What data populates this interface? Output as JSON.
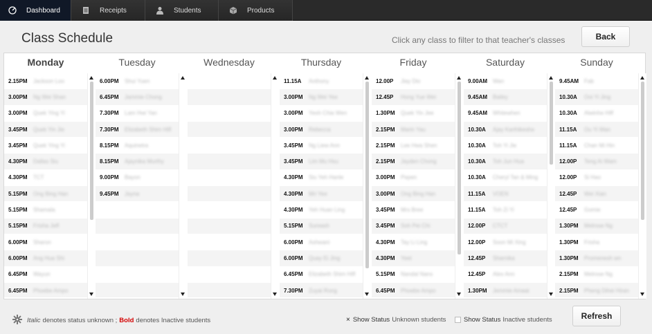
{
  "nav": [
    {
      "label": "Dashboard",
      "icon": "dashboard-icon",
      "active": true
    },
    {
      "label": "Receipts",
      "icon": "receipt-icon",
      "active": false
    },
    {
      "label": "Students",
      "icon": "user-icon",
      "active": false
    },
    {
      "label": "Products",
      "icon": "box-icon",
      "active": false
    }
  ],
  "page_title": "Class Schedule",
  "hint": "Click any class to filter to that teacher's classes",
  "back_label": "Back",
  "refresh_label": "Refresh",
  "days": [
    {
      "name": "Monday",
      "bold": true,
      "rows": [
        {
          "time": "2.15PM",
          "name": "Jackson Loo"
        },
        {
          "time": "3.00PM",
          "name": "Ng Wei Shan"
        },
        {
          "time": "3.00PM",
          "name": "Quek Ying Yi"
        },
        {
          "time": "3.45PM",
          "name": "Quek Yin Jie"
        },
        {
          "time": "3.45PM",
          "name": "Quek Ying Yi"
        },
        {
          "time": "4.30PM",
          "name": "Dallas Siu"
        },
        {
          "time": "4.30PM",
          "name": "TCT"
        },
        {
          "time": "5.15PM",
          "name": "Ong Bing Han"
        },
        {
          "time": "5.15PM",
          "name": "Shamala"
        },
        {
          "time": "5.15PM",
          "name": "Frisha Jeff"
        },
        {
          "time": "6.00PM",
          "name": "Sharon"
        },
        {
          "time": "6.00PM",
          "name": "Ang Hua Shi"
        },
        {
          "time": "6.45PM",
          "name": "Wayun"
        },
        {
          "time": "6.45PM",
          "name": "Phoebe Ampo"
        }
      ]
    },
    {
      "name": "Tuesday",
      "bold": false,
      "rows": [
        {
          "time": "6.00PM",
          "name": "Shui Yuen"
        },
        {
          "time": "6.45PM",
          "name": "Jammie Chong"
        },
        {
          "time": "7.30PM",
          "name": "Lam Hwi Yan"
        },
        {
          "time": "7.30PM",
          "name": "Elizabeth Shim Hiff"
        },
        {
          "time": "8.15PM",
          "name": "Aquinetra"
        },
        {
          "time": "8.15PM",
          "name": "Ajaynika Murthy"
        },
        {
          "time": "9.00PM",
          "name": "Bayon"
        },
        {
          "time": "9.45PM",
          "name": "Jayna"
        }
      ]
    },
    {
      "name": "Wednesday",
      "bold": false,
      "rows": []
    },
    {
      "name": "Thursday",
      "bold": false,
      "rows": [
        {
          "time": "11.15A",
          "name": "Anthony"
        },
        {
          "time": "3.00PM",
          "name": "Ng Wei Yee"
        },
        {
          "time": "3.00PM",
          "name": "Yeoh Chia Wen"
        },
        {
          "time": "3.00PM",
          "name": "Rebecca"
        },
        {
          "time": "3.45PM",
          "name": "Ng Liew Ann"
        },
        {
          "time": "3.45PM",
          "name": "Lim Mu Hsu"
        },
        {
          "time": "4.30PM",
          "name": "Siu Yeh Hanle"
        },
        {
          "time": "4.30PM",
          "name": "Mri Yee"
        },
        {
          "time": "4.30PM",
          "name": "Yeh Huan Ling"
        },
        {
          "time": "5.15PM",
          "name": "Sureash"
        },
        {
          "time": "6.00PM",
          "name": "Ashwani"
        },
        {
          "time": "6.00PM",
          "name": "Quay Ei Jing"
        },
        {
          "time": "6.45PM",
          "name": "Elizabeth Shim Hiff"
        },
        {
          "time": "7.30PM",
          "name": "Zuyai Rong"
        }
      ]
    },
    {
      "name": "Friday",
      "bold": false,
      "rows": [
        {
          "time": "12.00P",
          "name": "Jiay Dio"
        },
        {
          "time": "12.45P",
          "name": "Hong Yue Wei"
        },
        {
          "time": "1.30PM",
          "name": "Quek Yin Jee"
        },
        {
          "time": "2.15PM",
          "name": "Marin Yau"
        },
        {
          "time": "2.15PM",
          "name": "Lee Hwa Shen"
        },
        {
          "time": "2.15PM",
          "name": "Jayden Chong"
        },
        {
          "time": "3.00PM",
          "name": "Pepen"
        },
        {
          "time": "3.00PM",
          "name": "Ong Bing Han"
        },
        {
          "time": "3.45PM",
          "name": "Mrs Bree"
        },
        {
          "time": "3.45PM",
          "name": "Soh Pei Chi"
        },
        {
          "time": "4.30PM",
          "name": "Tay Li Ling"
        },
        {
          "time": "4.30PM",
          "name": "Yeet"
        },
        {
          "time": "5.15PM",
          "name": "Nandal Nans"
        },
        {
          "time": "6.45PM",
          "name": "Phoebe Ampo"
        }
      ]
    },
    {
      "name": "Saturday",
      "bold": false,
      "rows": [
        {
          "time": "9.00AM",
          "name": "Wan"
        },
        {
          "time": "9.45AM",
          "name": "Bailey"
        },
        {
          "time": "9.45AM",
          "name": "Whitewhen"
        },
        {
          "time": "10.30A",
          "name": "Ajay Karthikeshe"
        },
        {
          "time": "10.30A",
          "name": "Toh Yi Jie"
        },
        {
          "time": "10.30A",
          "name": "Toh Jun Hua"
        },
        {
          "time": "10.30A",
          "name": "Cheryl Tan & Ming"
        },
        {
          "time": "11.15A",
          "name": "VOEN"
        },
        {
          "time": "11.15A",
          "name": "Toh Zi Yi"
        },
        {
          "time": "12.00P",
          "name": "CTCT"
        },
        {
          "time": "12.00P",
          "name": "Soon Mi Xing"
        },
        {
          "time": "12.45P",
          "name": "Sharnika"
        },
        {
          "time": "12.45P",
          "name": "Alex Ann"
        },
        {
          "time": "1.30PM",
          "name": "Jemmie Amaai"
        }
      ]
    },
    {
      "name": "Sunday",
      "bold": false,
      "rows": [
        {
          "time": "9.45AM",
          "name": "Fab"
        },
        {
          "time": "10.30A",
          "name": "Ooi Yi Jing"
        },
        {
          "time": "10.30A",
          "name": "Alwinhe Hiff"
        },
        {
          "time": "11.15A",
          "name": "Ou Yi Wan"
        },
        {
          "time": "11.15A",
          "name": "Chan Mi Hin"
        },
        {
          "time": "12.00P",
          "name": "Teng Ai Wam"
        },
        {
          "time": "12.00P",
          "name": "Si Hao"
        },
        {
          "time": "12.45P",
          "name": "Wei Xian"
        },
        {
          "time": "12.45P",
          "name": "Gomie"
        },
        {
          "time": "1.30PM",
          "name": "Melrose Ng"
        },
        {
          "time": "1.30PM",
          "name": "Frisha"
        },
        {
          "time": "1.30PM",
          "name": "Promenesh wn"
        },
        {
          "time": "2.15PM",
          "name": "Melrose Ng"
        },
        {
          "time": "2.15PM",
          "name": "Pheng Dihei Hiran"
        }
      ]
    }
  ],
  "legend": {
    "italic": "Italic",
    "text1": "denotes status unknown ;",
    "bold": "Bold",
    "text2": "denotes Inactive students"
  },
  "toggles": [
    {
      "mark": "×",
      "label_key": "Show Status",
      "label_rest": "Unknown students",
      "checked": true
    },
    {
      "mark": "",
      "label_key": "Show Status",
      "label_rest": "Inactive students",
      "checked": false
    }
  ]
}
